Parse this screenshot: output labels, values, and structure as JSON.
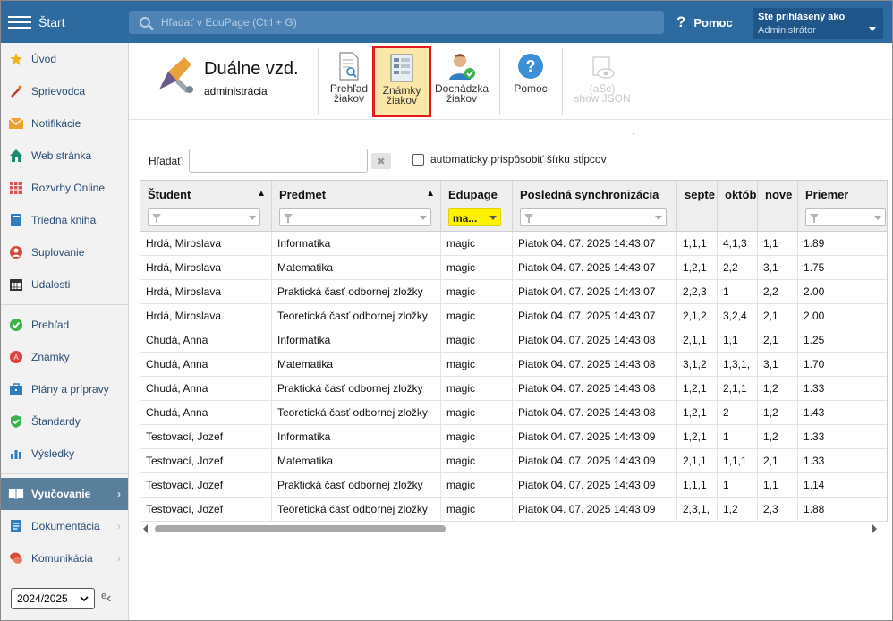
{
  "topbar": {
    "start_label": "Štart",
    "search_placeholder": "Hľadať v EduPage (Ctrl + G)",
    "help_label": "Pomoc",
    "user_line1": "Ste prihlásený ako",
    "user_line2": "Administrátor"
  },
  "sidebar": {
    "items": [
      {
        "label": "Úvod",
        "icon": "star-icon"
      },
      {
        "label": "Sprievodca",
        "icon": "wand-icon"
      },
      {
        "label": "Notifikácie",
        "icon": "envelope-icon"
      },
      {
        "label": "Web stránka",
        "icon": "house-icon"
      },
      {
        "label": "Rozvrhy Online",
        "icon": "calendar-grid-icon"
      },
      {
        "label": "Triedna kniha",
        "icon": "book-icon"
      },
      {
        "label": "Suplovanie",
        "icon": "person-swap-icon"
      },
      {
        "label": "Udalosti",
        "icon": "calendar-icon"
      },
      {
        "label": "Prehľad",
        "icon": "check-circle-icon"
      },
      {
        "label": "Známky",
        "icon": "grade-icon"
      },
      {
        "label": "Plány a prípravy",
        "icon": "briefcase-icon"
      },
      {
        "label": "Štandardy",
        "icon": "shield-check-icon"
      },
      {
        "label": "Výsledky",
        "icon": "bar-chart-icon"
      },
      {
        "label": "Vyučovanie",
        "icon": "open-book-icon"
      },
      {
        "label": "Dokumentácia",
        "icon": "document-icon"
      },
      {
        "label": "Komunikácia",
        "icon": "chat-icon"
      }
    ],
    "year": "2024/2025",
    "clipped_letter": "e"
  },
  "toolbar": {
    "module_title": "Duálne vzd.",
    "module_subtitle": "administrácia",
    "buttons": [
      {
        "line1": "Prehľad",
        "line2": "žiakov"
      },
      {
        "line1": "Známky",
        "line2": "žiakov"
      },
      {
        "line1": "Dochádzka",
        "line2": "žiakov"
      },
      {
        "line1": "Pomoc",
        "line2": ""
      },
      {
        "line1": "(aSc)",
        "line2": "show JSON"
      }
    ]
  },
  "filter": {
    "search_label": "Hľadať:",
    "search_value": "",
    "clear_label": "✖",
    "autofit_label": "automaticky prispôsobiť šírku stĺpcov"
  },
  "grid": {
    "columns": [
      "Študent",
      "Predmet",
      "Edupage",
      "Posledná synchronizácia",
      "septe",
      "októb",
      "nove",
      "Priemer"
    ],
    "edupage_filter": "ma...",
    "rows": [
      [
        "Hrdá, Miroslava",
        "Informatika",
        "magic",
        "Piatok 04. 07. 2025 14:43:07",
        "1,1,1",
        "4,1,3",
        "1,1",
        "1.89"
      ],
      [
        "Hrdá, Miroslava",
        "Matematika",
        "magic",
        "Piatok 04. 07. 2025 14:43:07",
        "1,2,1",
        "2,2",
        "3,1",
        "1.75"
      ],
      [
        "Hrdá, Miroslava",
        "Praktická časť odbornej zložky",
        "magic",
        "Piatok 04. 07. 2025 14:43:07",
        "2,2,3",
        "1",
        "2,2",
        "2.00"
      ],
      [
        "Hrdá, Miroslava",
        "Teoretická časť odbornej zložky",
        "magic",
        "Piatok 04. 07. 2025 14:43:07",
        "2,1,2",
        "3,2,4",
        "2,1",
        "2.00"
      ],
      [
        "Chudá, Anna",
        "Informatika",
        "magic",
        "Piatok 04. 07. 2025 14:43:08",
        "2,1,1",
        "1,1",
        "2,1",
        "1.25"
      ],
      [
        "Chudá, Anna",
        "Matematika",
        "magic",
        "Piatok 04. 07. 2025 14:43:08",
        "3,1,2",
        "1,3,1,",
        "3,1",
        "1.70"
      ],
      [
        "Chudá, Anna",
        "Praktická časť odbornej zložky",
        "magic",
        "Piatok 04. 07. 2025 14:43:08",
        "1,2,1",
        "2,1,1",
        "1,2",
        "1.33"
      ],
      [
        "Chudá, Anna",
        "Teoretická časť odbornej zložky",
        "magic",
        "Piatok 04. 07. 2025 14:43:08",
        "1,2,1",
        "2",
        "1,2",
        "1.43"
      ],
      [
        "Testovací, Jozef",
        "Informatika",
        "magic",
        "Piatok 04. 07. 2025 14:43:09",
        "1,2,1",
        "1",
        "1,2",
        "1.33"
      ],
      [
        "Testovací, Jozef",
        "Matematika",
        "magic",
        "Piatok 04. 07. 2025 14:43:09",
        "2,1,1",
        "1,1,1",
        "2,1",
        "1.33"
      ],
      [
        "Testovací, Jozef",
        "Praktická časť odbornej zložky",
        "magic",
        "Piatok 04. 07. 2025 14:43:09",
        "1,1,1",
        "1",
        "1,1",
        "1.14"
      ],
      [
        "Testovací, Jozef",
        "Teoretická časť odbornej zložky",
        "magic",
        "Piatok 04. 07. 2025 14:43:09",
        "2,3,1,",
        "1,2",
        "2,3",
        "1.88"
      ]
    ]
  },
  "colors": {
    "topbar": "#2c6aa0",
    "active_sidebar": "#5a7f9a",
    "selected_button_border": "#e31b1b",
    "selected_button_bg": "#fbe8a8",
    "filter_highlight": "#fff200"
  }
}
